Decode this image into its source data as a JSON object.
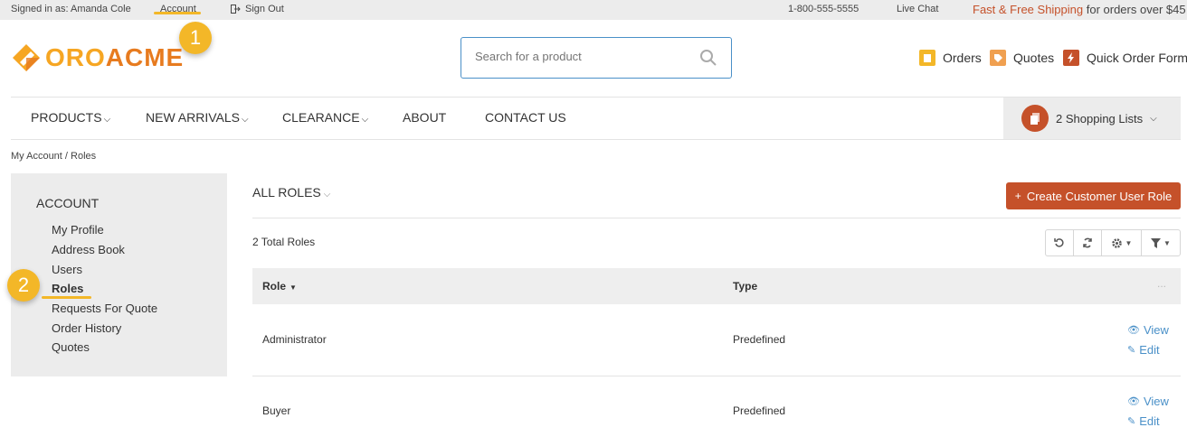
{
  "topbar": {
    "signed_in": "Signed in as: Amanda Cole",
    "account": "Account",
    "sign_out": "Sign Out",
    "phone": "1-800-555-5555",
    "live_chat": "Live Chat",
    "promo_highlight": "Fast & Free Shipping",
    "promo_rest": " for orders over $45"
  },
  "logo": {
    "part1": "ORO",
    "part2": "ACME"
  },
  "search": {
    "placeholder": "Search for a product"
  },
  "header_links": {
    "orders": "Orders",
    "quotes": "Quotes",
    "quick_order": "Quick Order Form"
  },
  "nav": {
    "items": [
      "PRODUCTS",
      "NEW ARRIVALS",
      "CLEARANCE",
      "ABOUT",
      "CONTACT US"
    ],
    "shopping_lists": "2 Shopping Lists"
  },
  "breadcrumb": "My Account / Roles",
  "sidebar": {
    "heading": "ACCOUNT",
    "items": [
      "My Profile",
      "Address Book",
      "Users",
      "Roles",
      "Requests For Quote",
      "Order History",
      "Quotes"
    ],
    "active": "Roles"
  },
  "badges": [
    "1",
    "2"
  ],
  "main": {
    "title": "ALL ROLES",
    "create_button": "Create Customer User Role",
    "total": "2 Total Roles",
    "columns": {
      "role": "Role",
      "type": "Type",
      "more": "..."
    },
    "rows": [
      {
        "role": "Administrator",
        "type": "Predefined"
      },
      {
        "role": "Buyer",
        "type": "Predefined"
      }
    ],
    "actions": {
      "view": "View",
      "edit": "Edit"
    }
  },
  "colors": {
    "accent": "#c5512a",
    "link": "#4a90c8",
    "badge": "#f3b728",
    "logo_light": "#f6a623",
    "logo_dark": "#e77b1f"
  }
}
